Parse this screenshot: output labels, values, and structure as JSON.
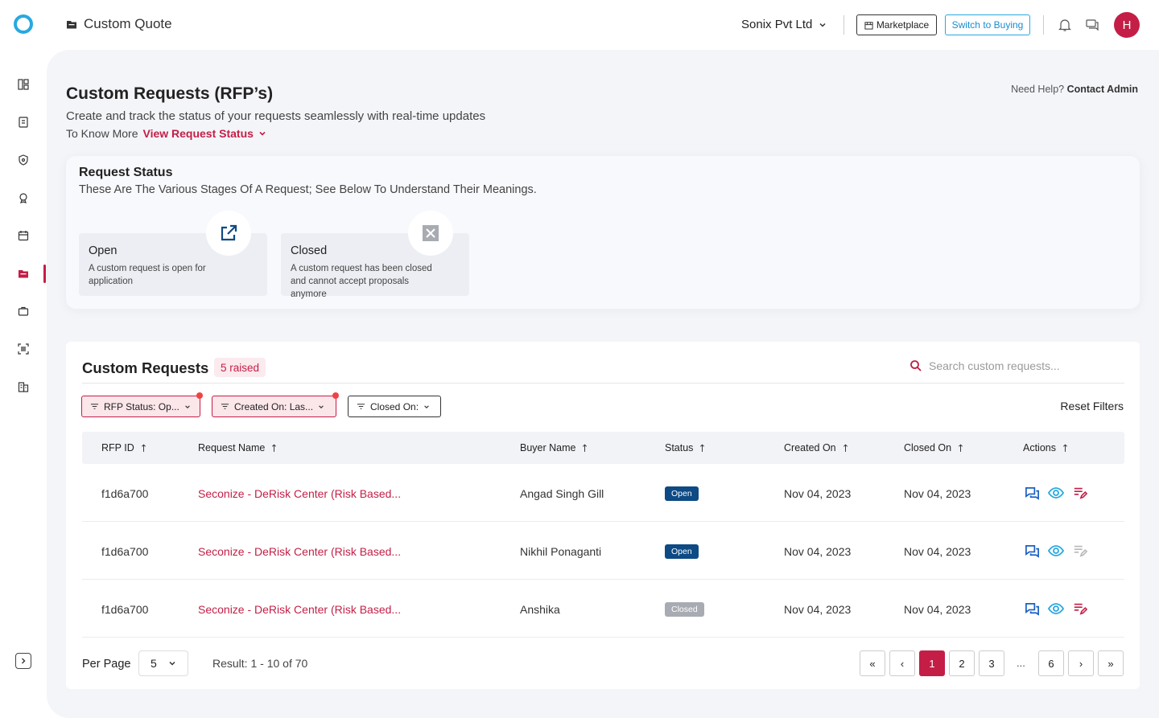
{
  "header": {
    "app_title": "Custom Quote",
    "company": "Sonix Pvt Ltd",
    "marketplace_label": "Marketplace",
    "switch_label": "Switch to Buying",
    "avatar_initial": "H"
  },
  "page": {
    "title": "Custom Requests (RFP’s)",
    "subtitle": "Create and track the status of your requests seamlessly with real-time updates",
    "know_more_prefix": "To Know More",
    "know_more_link": "View Request Status",
    "help_prefix": "Need Help?",
    "help_link": "Contact Admin"
  },
  "status_panel": {
    "title": "Request Status",
    "subtitle": "These Are The Various Stages Of A Request; See Below To Understand Their Meanings.",
    "stages": [
      {
        "name": "Open",
        "description": "A custom request is open for application"
      },
      {
        "name": "Closed",
        "description": "A custom request has been closed and cannot accept proposals anymore"
      }
    ]
  },
  "requests": {
    "title": "Custom Requests",
    "badge": "5 raised",
    "search_placeholder": "Search custom requests...",
    "filters": [
      {
        "label": "RFP Status: Op...",
        "active": true
      },
      {
        "label": "Created On: Las...",
        "active": true
      },
      {
        "label": "Closed On:",
        "active": false
      }
    ],
    "reset_label": "Reset Filters",
    "columns": [
      "RFP ID",
      "Request Name",
      "Buyer Name",
      "Status",
      "Created On",
      "Closed On",
      "Actions"
    ],
    "rows": [
      {
        "id": "f1d6a700",
        "name": "Seconize - DeRisk Center (Risk Based...",
        "buyer": "Angad Singh Gill",
        "status": "Open",
        "created": "Nov 04, 2023",
        "closed": "Nov 04, 2023"
      },
      {
        "id": "f1d6a700",
        "name": "Seconize - DeRisk Center (Risk Based...",
        "buyer": "Nikhil Ponaganti",
        "status": "Open",
        "created": "Nov 04, 2023",
        "closed": "Nov 04, 2023"
      },
      {
        "id": "f1d6a700",
        "name": "Seconize - DeRisk Center (Risk Based...",
        "buyer": "Anshika",
        "status": "Closed",
        "created": "Nov 04, 2023",
        "closed": "Nov 04, 2023"
      }
    ],
    "footer": {
      "per_page_label": "Per Page",
      "per_page_value": "5",
      "result": "Result: 1 - 10 of 70",
      "pages": [
        "1",
        "2",
        "3",
        "6"
      ],
      "ellipsis": "...",
      "first": "«",
      "prev": "‹",
      "next": "›",
      "last": "»",
      "current_page": "1"
    }
  },
  "colors": {
    "brand": "#c41e46",
    "accent_blue": "#29a8e0",
    "status_open": "#0e4a84",
    "status_closed": "#a9abb3"
  }
}
